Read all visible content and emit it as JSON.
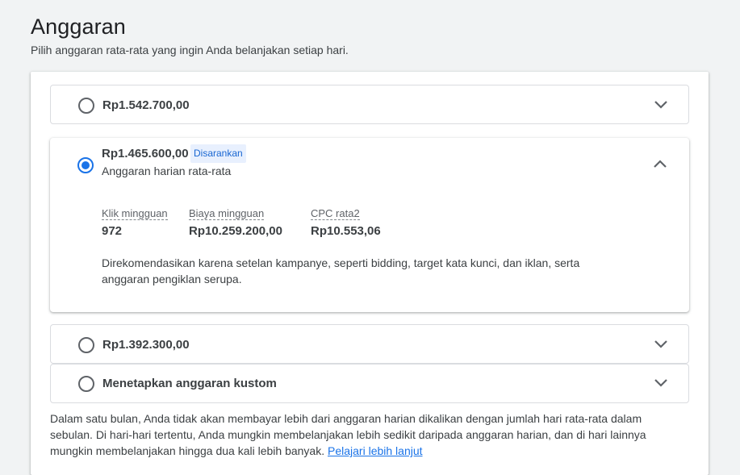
{
  "header": {
    "title": "Anggaran",
    "subtitle": "Pilih anggaran rata-rata yang ingin Anda belanjakan setiap hari."
  },
  "options": [
    {
      "label": "Rp1.542.700,00",
      "selected": false
    },
    {
      "label": "Rp1.465.600,00",
      "selected": true,
      "badge": "Disarankan",
      "sublabel": "Anggaran harian rata-rata",
      "stats": [
        {
          "label": "Klik mingguan",
          "value": "972"
        },
        {
          "label": "Biaya mingguan",
          "value": "Rp10.259.200,00"
        },
        {
          "label": "CPC rata2",
          "value": "Rp10.553,06"
        }
      ],
      "description": "Direkomendasikan karena setelan kampanye, seperti bidding, target kata kunci, dan iklan, serta anggaran pengiklan serupa."
    },
    {
      "label": "Rp1.392.300,00",
      "selected": false
    },
    {
      "label": "Menetapkan anggaran kustom",
      "selected": false
    }
  ],
  "footnote": {
    "text": "Dalam satu bulan, Anda tidak akan membayar lebih dari anggaran harian dikalikan dengan jumlah hari rata-rata dalam sebulan. Di hari-hari tertentu, Anda mungkin membelanjakan lebih sedikit daripada anggaran harian, dan di hari lainnya mungkin membelanjakan hingga dua kali lebih banyak.",
    "link": "Pelajari lebih lanjut"
  },
  "colors": {
    "accent": "#1a73e8",
    "badge_bg": "#e8f0fe",
    "page_bg": "#f1f3f4"
  },
  "icons": {
    "collapsed": "chevron-down-icon",
    "expanded": "chevron-up-icon"
  }
}
